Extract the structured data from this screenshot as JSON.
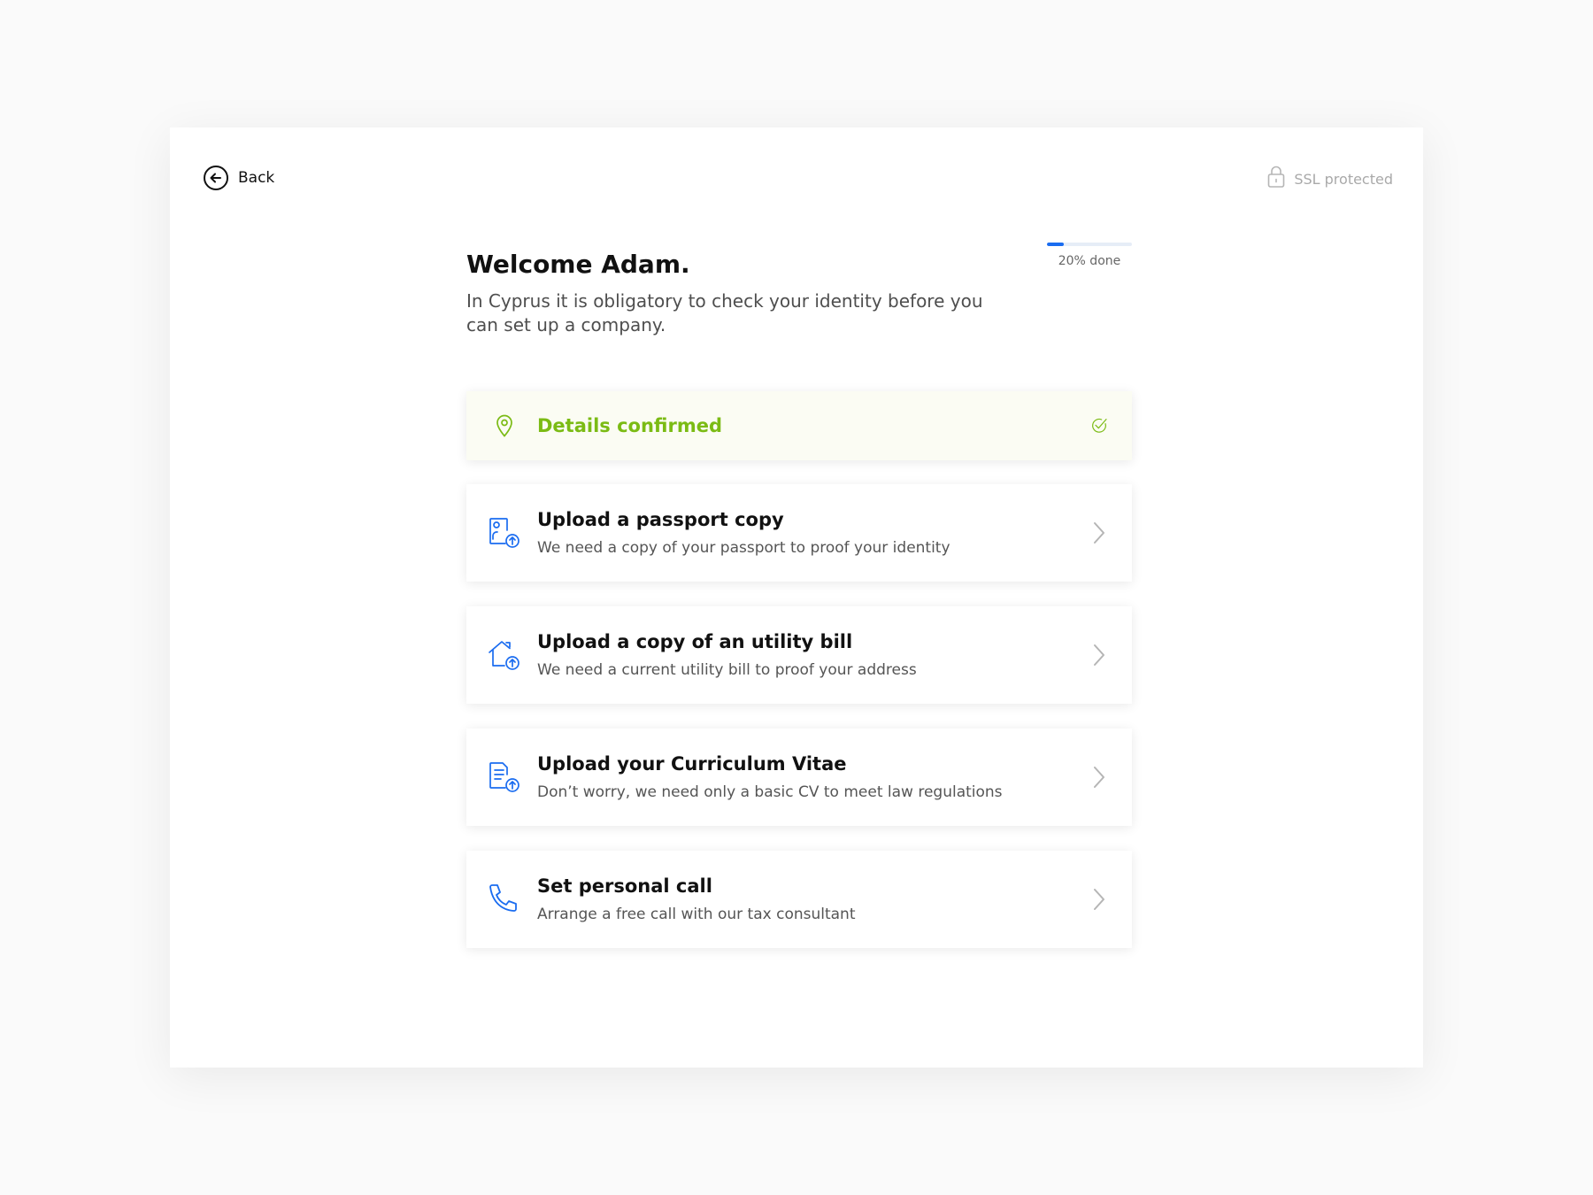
{
  "header": {
    "back_label": "Back",
    "ssl_label": "SSL protected"
  },
  "welcome": {
    "title": "Welcome Adam.",
    "subtitle": "In Cyprus it is obligatory to check your identity before you can set up a company."
  },
  "progress": {
    "value": 0.2,
    "label": "20% done"
  },
  "colors": {
    "accent_blue": "#1a6cf0",
    "success_green": "#7bbb14",
    "chevron_gray": "#b5b5b5"
  },
  "steps": [
    {
      "title": "Details confirmed",
      "description": "",
      "icon": "location-pin-icon",
      "status": "confirmed"
    },
    {
      "title": "Upload a passport copy",
      "description": "We need a copy of your passport to proof your identity",
      "icon": "passport-upload-icon"
    },
    {
      "title": "Upload a copy of an utility bill",
      "description": "We need a current utility bill to proof your address",
      "icon": "house-upload-icon"
    },
    {
      "title": "Upload your Curriculum Vitae",
      "description": "Don’t worry, we need only a basic CV to meet law regulations",
      "icon": "document-upload-icon"
    },
    {
      "title": "Set personal call",
      "description": "Arrange a free call with our tax consultant",
      "icon": "phone-icon"
    }
  ]
}
